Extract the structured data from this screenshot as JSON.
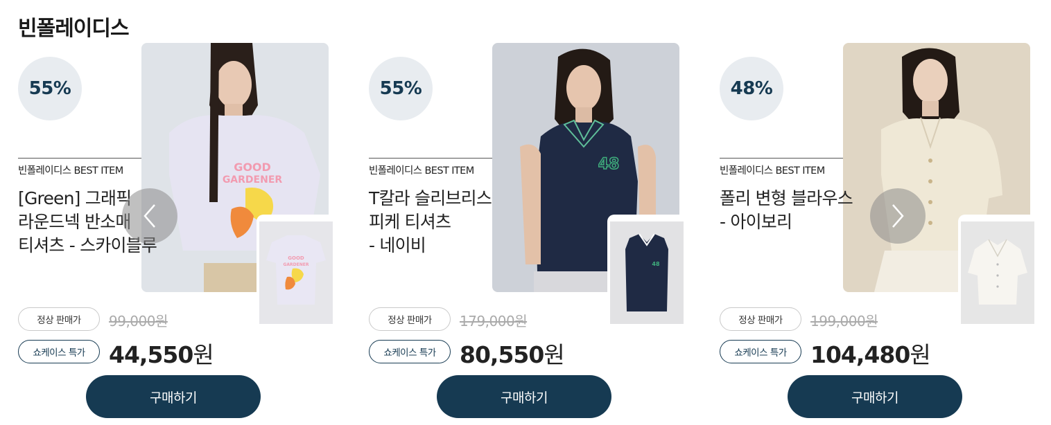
{
  "brand_title": "빈폴레이디스",
  "carousel": {
    "prev_label": "이전",
    "next_label": "다음"
  },
  "products": [
    {
      "discount": "55%",
      "best_label": "빈폴레이디스 BEST ITEM",
      "name_lines": [
        "[Green] 그래픽",
        "라운드넥 반소매",
        "티셔츠 - 스카이블루"
      ],
      "regular_label": "정상 판매가",
      "original_price": "99,000원",
      "special_label": "쇼케이스 특가",
      "sale_price": "44,550",
      "currency": "원",
      "buy_label": "구매하기",
      "photo_bg": "#dfe3e8",
      "garment_color": "#e6e4f2"
    },
    {
      "discount": "55%",
      "best_label": "빈폴레이디스 BEST ITEM",
      "name_lines": [
        "T칼라 슬리브리스",
        "피케 티셔츠",
        "- 네이비"
      ],
      "regular_label": "정상 판매가",
      "original_price": "179,000원",
      "special_label": "쇼케이스 특가",
      "sale_price": "80,550",
      "currency": "원",
      "buy_label": "구매하기",
      "photo_bg": "#cdd1d8",
      "garment_color": "#1f2a44"
    },
    {
      "discount": "48%",
      "best_label": "빈폴레이디스 BEST ITEM",
      "name_lines": [
        "폴리 변형 블라우스",
        "- 아이보리"
      ],
      "regular_label": "정상 판매가",
      "original_price": "199,000원",
      "special_label": "쇼케이스 특가",
      "sale_price": "104,480",
      "currency": "원",
      "buy_label": "구매하기",
      "photo_bg": "#e0d6c4",
      "garment_color": "#efe8d6"
    }
  ]
}
